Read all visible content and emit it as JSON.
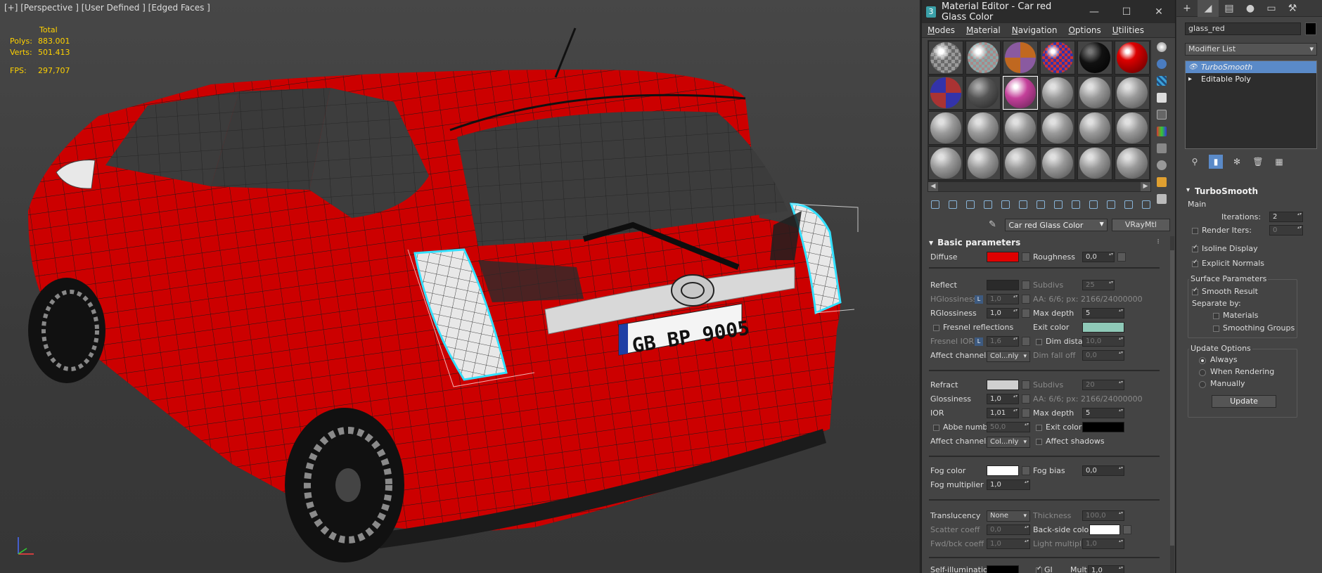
{
  "viewport": {
    "label": "[+] [Perspective ] [User Defined ] [Edged Faces ]",
    "stats": {
      "header": "Total",
      "polys_label": "Polys:",
      "polys_value": "883.001",
      "verts_label": "Verts:",
      "verts_value": "501.413",
      "fps_label": "FPS:",
      "fps_value": "297,707"
    },
    "plate_text": "GB BP 9005",
    "colors": {
      "body": "#cc0000",
      "stats": "#ffd200",
      "wire": "#1a1a1a",
      "select": "#33e0ff"
    }
  },
  "material_editor": {
    "title": "Material Editor - Car red Glass Color",
    "window_buttons": [
      "—",
      "☐",
      "✕"
    ],
    "menu": [
      "Modes",
      "Material",
      "Navigation",
      "Options",
      "Utilities"
    ],
    "slots": [
      {
        "kind": "checker"
      },
      {
        "kind": "checker2"
      },
      {
        "kind": "orange"
      },
      {
        "kind": "multi"
      },
      {
        "kind": "black"
      },
      {
        "kind": "red"
      },
      {
        "kind": "multi2"
      },
      {
        "kind": "dark"
      },
      {
        "kind": "pink"
      },
      {
        "kind": "gray"
      },
      {
        "kind": "gray"
      },
      {
        "kind": "gray"
      },
      {
        "kind": "gray"
      },
      {
        "kind": "gray"
      },
      {
        "kind": "gray"
      },
      {
        "kind": "gray"
      },
      {
        "kind": "gray"
      },
      {
        "kind": "gray"
      },
      {
        "kind": "gray"
      },
      {
        "kind": "gray"
      },
      {
        "kind": "gray"
      },
      {
        "kind": "gray"
      },
      {
        "kind": "gray"
      },
      {
        "kind": "gray"
      }
    ],
    "material_name": "Car red Glass Color",
    "material_type": "VRayMtl",
    "rollout_title": "Basic parameters",
    "diffuse_label": "Diffuse",
    "diffuse_color": "#e00000",
    "roughness_label": "Roughness",
    "roughness_value": "0,0",
    "reflect_label": "Reflect",
    "reflect_color": "#2a2a2a",
    "subdivs_label": "Subdivs",
    "reflect_subdivs": "25",
    "hglossiness_label": "HGlossiness",
    "hglossiness_value": "1,0",
    "aa_label": "AA: 6/6; px: 2166/24000000",
    "rglossiness_label": "RGlossiness",
    "rglossiness_value": "1,0",
    "maxdepth_label": "Max depth",
    "reflect_maxdepth": "5",
    "fresnel_label": "Fresnel reflections",
    "exitcolor_label": "Exit color",
    "reflect_exit_color": "#8fc9b8",
    "fresnel_ior_label": "Fresnel IOR",
    "fresnel_ior_value": "1,6",
    "dimdist_label": "Dim distance",
    "dimdist_value": "10,0",
    "affect_label": "Affect channels",
    "affect_value": "Col...nly",
    "dimfall_label": "Dim fall off",
    "dimfall_value": "0,0",
    "l_badge": "L",
    "refract_label": "Refract",
    "refract_color": "#cfcfcf",
    "refract_subdivs": "20",
    "glossiness_label": "Glossiness",
    "glossiness_value": "1,0",
    "ior_label": "IOR",
    "ior_value": "1,01",
    "refract_maxdepth": "5",
    "abbe_label": "Abbe number",
    "abbe_value": "50,0",
    "refract_exit_color": "#000000",
    "affect_shadows_label": "Affect shadows",
    "fogcolor_label": "Fog color",
    "fog_color": "#ffffff",
    "fogbias_label": "Fog bias",
    "fogbias_value": "0,0",
    "fogmult_label": "Fog multiplier",
    "fogmult_value": "1,0",
    "translucency_label": "Translucency",
    "translucency_value": "None",
    "thickness_label": "Thickness",
    "thickness_value": "100,0",
    "scatter_label": "Scatter coeff",
    "scatter_value": "0,0",
    "backside_label": "Back-side color",
    "backside_color": "#ffffff",
    "fwdbck_label": "Fwd/bck coeff",
    "fwdbck_value": "1,0",
    "lightmult_label": "Light multiplier",
    "lightmult_value": "1,0",
    "selfillum_label": "Self-illumination",
    "selfillum_color": "#000000",
    "gi_label": "GI",
    "mult_label": "Mult",
    "mult_value": "1,0"
  },
  "command_panel": {
    "object_name": "glass_red",
    "object_color": "#000000",
    "modifier_list": "Modifier List",
    "stack": [
      {
        "label": "TurboSmooth",
        "selected": true
      },
      {
        "label": "Editable Poly",
        "selected": false
      }
    ],
    "turbosmooth": {
      "title": "TurboSmooth",
      "main_label": "Main",
      "iterations_label": "Iterations:",
      "iterations_value": "2",
      "render_iters_label": "Render Iters:",
      "render_iters_value": "0",
      "isoline_label": "Isoline Display",
      "explicit_label": "Explicit Normals",
      "surface_label": "Surface Parameters",
      "smooth_result_label": "Smooth Result",
      "separate_label": "Separate by:",
      "materials_label": "Materials",
      "smoothing_label": "Smoothing Groups",
      "update_options_label": "Update Options",
      "always_label": "Always",
      "when_rendering_label": "When Rendering",
      "manually_label": "Manually",
      "update_button": "Update"
    }
  }
}
